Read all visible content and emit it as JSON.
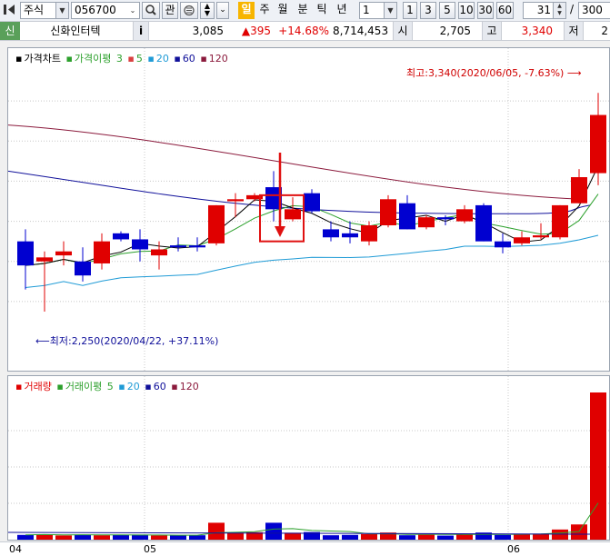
{
  "toolbar": {
    "market": "주식",
    "code": "056700",
    "watch_label": "관",
    "periods": [
      "일",
      "주",
      "월",
      "분",
      "틱",
      "년"
    ],
    "active_period": "일",
    "interval_value": "1",
    "interval_buttons": [
      "1",
      "3",
      "5",
      "10",
      "30",
      "60"
    ],
    "count_value": "31",
    "slash": "/",
    "total_value": "300"
  },
  "quote": {
    "badge": "신",
    "name": "신화인터텍",
    "info_label": "i",
    "price": "3,085",
    "change": "▲395",
    "change_pct": "+14.68%",
    "volume": "8,714,453",
    "open_label": "시",
    "open": "2,705",
    "high_label": "고",
    "high": "3,340",
    "low_label": "저",
    "low_partial": "2"
  },
  "price_legend": {
    "title": "가격차트",
    "ma_label": "가격이평",
    "ma_periods": [
      "3",
      "5",
      "20",
      "60",
      "120"
    ]
  },
  "volume_legend": {
    "title": "거래량",
    "ma_label": "거래이평",
    "ma_periods": [
      "5",
      "20",
      "60",
      "120"
    ]
  },
  "annotations": {
    "high": "최고:3,340(2020/06/05, -7.63%)",
    "low": "최저:2,250(2020/04/22, +37.11%)"
  },
  "x_axis": {
    "labels": [
      "04",
      "05",
      "06"
    ]
  },
  "colors": {
    "up": "#e00000",
    "down": "#0000d0",
    "ma3": "#000000",
    "ma5": "#2ca02c",
    "ma20": "#1f9bd6",
    "ma60": "#10109a",
    "ma120": "#8b1a3c",
    "active_period": "#f7b500"
  },
  "chart_data": {
    "type": "candlestick",
    "y_range": [
      2200,
      3400
    ],
    "candles": [
      {
        "o": 2600,
        "h": 2660,
        "l": 2360,
        "c": 2480,
        "up": false
      },
      {
        "o": 2520,
        "h": 2550,
        "l": 2250,
        "c": 2500,
        "up": true
      },
      {
        "o": 2530,
        "h": 2600,
        "l": 2480,
        "c": 2550,
        "up": true
      },
      {
        "o": 2500,
        "h": 2570,
        "l": 2400,
        "c": 2430,
        "up": false
      },
      {
        "o": 2490,
        "h": 2640,
        "l": 2460,
        "c": 2600,
        "up": true
      },
      {
        "o": 2640,
        "h": 2650,
        "l": 2600,
        "c": 2610,
        "up": false
      },
      {
        "o": 2610,
        "h": 2660,
        "l": 2500,
        "c": 2560,
        "up": false
      },
      {
        "o": 2530,
        "h": 2600,
        "l": 2460,
        "c": 2560,
        "up": true
      },
      {
        "o": 2570,
        "h": 2620,
        "l": 2550,
        "c": 2580,
        "up": false
      },
      {
        "o": 2570,
        "h": 2620,
        "l": 2550,
        "c": 2580,
        "up": false
      },
      {
        "o": 2590,
        "h": 2780,
        "l": 2580,
        "c": 2780,
        "up": true
      },
      {
        "o": 2800,
        "h": 2840,
        "l": 2720,
        "c": 2810,
        "up": true
      },
      {
        "o": 2810,
        "h": 2840,
        "l": 2800,
        "c": 2830,
        "up": true
      },
      {
        "o": 2870,
        "h": 2950,
        "l": 2700,
        "c": 2760,
        "up": false
      },
      {
        "o": 2760,
        "h": 2820,
        "l": 2700,
        "c": 2710,
        "up": true
      },
      {
        "o": 2840,
        "h": 2860,
        "l": 2740,
        "c": 2750,
        "up": false
      },
      {
        "o": 2660,
        "h": 2700,
        "l": 2600,
        "c": 2620,
        "up": false
      },
      {
        "o": 2640,
        "h": 2700,
        "l": 2590,
        "c": 2620,
        "up": false
      },
      {
        "o": 2600,
        "h": 2700,
        "l": 2580,
        "c": 2680,
        "up": true
      },
      {
        "o": 2680,
        "h": 2830,
        "l": 2670,
        "c": 2810,
        "up": true
      },
      {
        "o": 2790,
        "h": 2830,
        "l": 2660,
        "c": 2660,
        "up": false
      },
      {
        "o": 2670,
        "h": 2730,
        "l": 2660,
        "c": 2720,
        "up": true
      },
      {
        "o": 2710,
        "h": 2730,
        "l": 2680,
        "c": 2720,
        "up": false
      },
      {
        "o": 2700,
        "h": 2780,
        "l": 2690,
        "c": 2760,
        "up": true
      },
      {
        "o": 2780,
        "h": 2790,
        "l": 2600,
        "c": 2600,
        "up": false
      },
      {
        "o": 2600,
        "h": 2640,
        "l": 2540,
        "c": 2570,
        "up": false
      },
      {
        "o": 2590,
        "h": 2650,
        "l": 2580,
        "c": 2620,
        "up": true
      },
      {
        "o": 2620,
        "h": 2690,
        "l": 2610,
        "c": 2630,
        "up": true
      },
      {
        "o": 2620,
        "h": 2780,
        "l": 2610,
        "c": 2780,
        "up": true
      },
      {
        "o": 2790,
        "h": 2960,
        "l": 2790,
        "c": 2920,
        "up": true
      },
      {
        "o": 2940,
        "h": 3340,
        "l": 2880,
        "c": 3230,
        "up": true
      }
    ],
    "volume_max": 8714453,
    "volumes": [
      280000,
      320000,
      250000,
      300000,
      260000,
      270000,
      300000,
      250000,
      240000,
      260000,
      1000000,
      420000,
      440000,
      1000000,
      410000,
      450000,
      260000,
      280000,
      330000,
      420000,
      260000,
      290000,
      240000,
      330000,
      420000,
      280000,
      300000,
      340000,
      600000,
      900000,
      8714453
    ],
    "ma60_start_end": [
      2950,
      2780
    ],
    "ma120_start_end": [
      3180,
      2810
    ]
  }
}
